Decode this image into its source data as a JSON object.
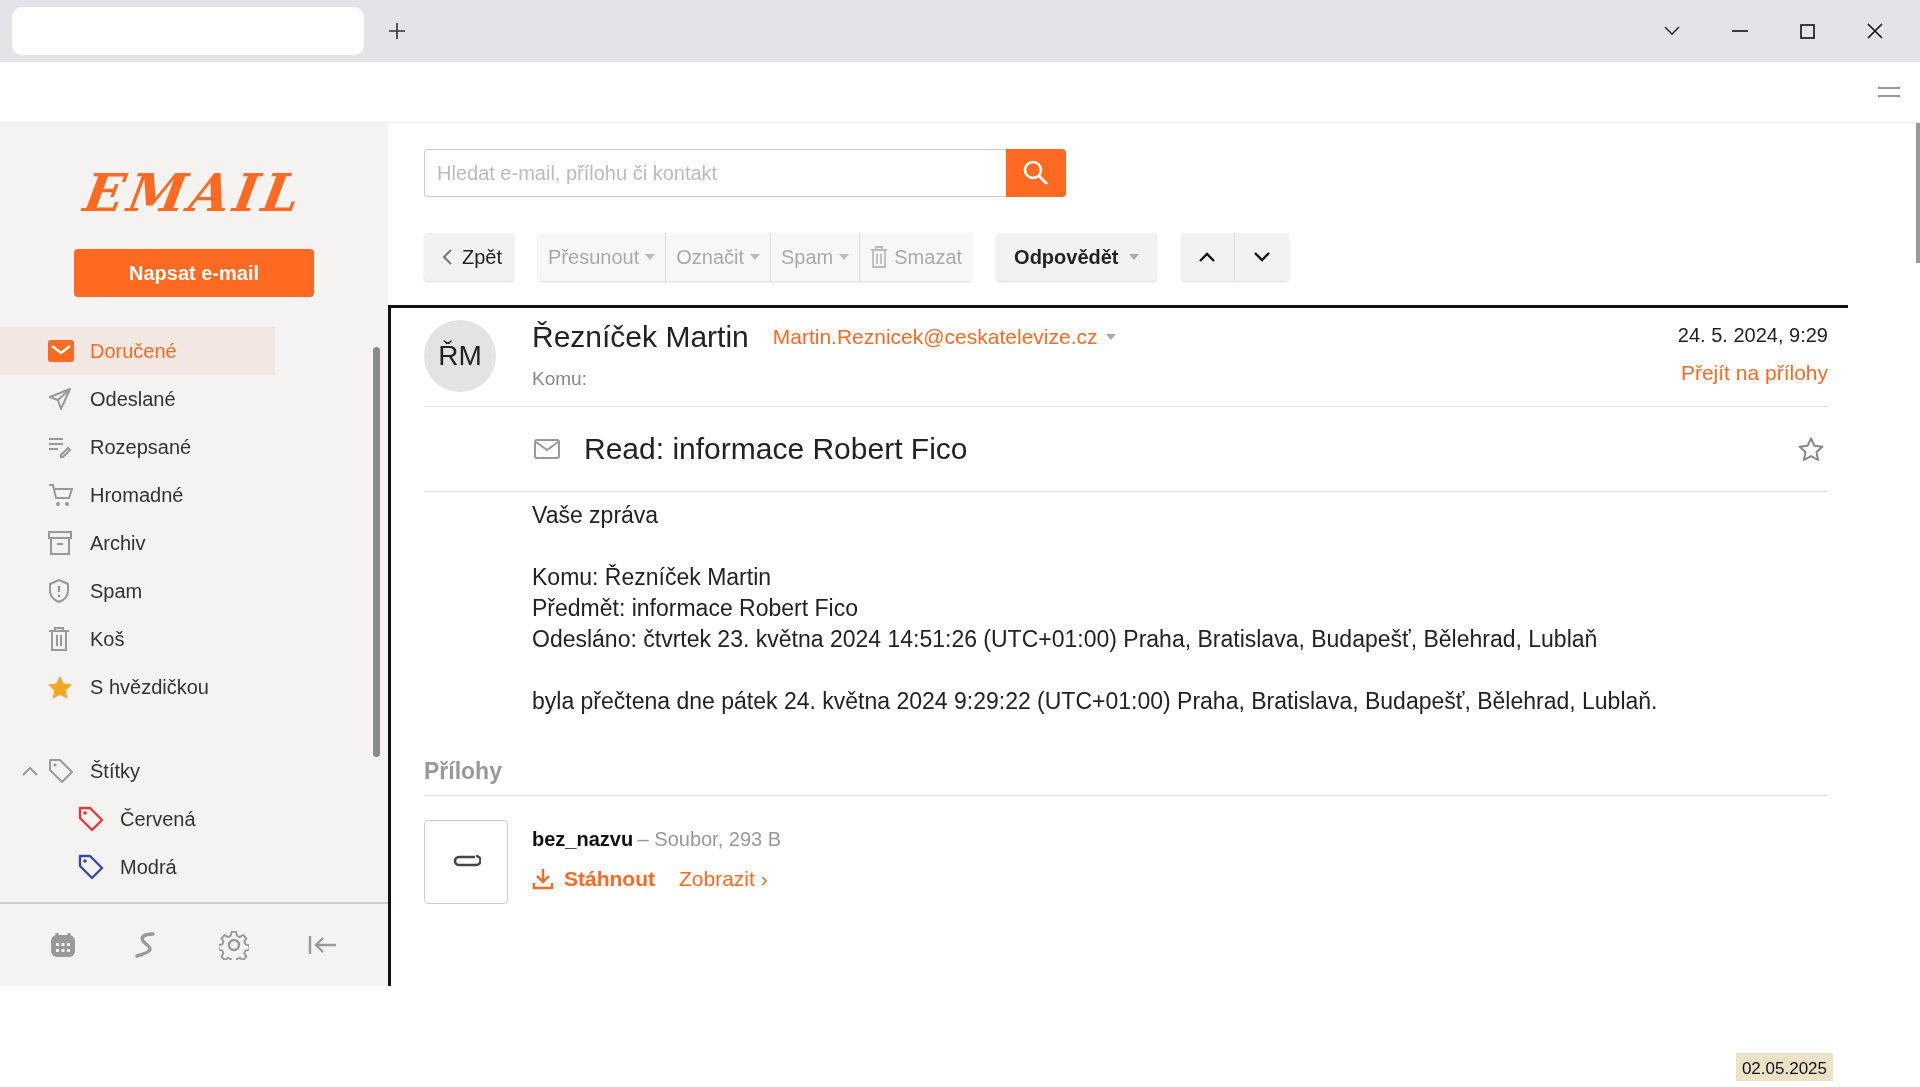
{
  "sidebar": {
    "logo": "EMAIL",
    "compose": "Napsat e-mail",
    "folders": [
      {
        "label": "Doručené",
        "kind": "inbox",
        "selected": true
      },
      {
        "label": "Odeslané",
        "kind": "sent",
        "selected": false
      },
      {
        "label": "Rozepsané",
        "kind": "drafts",
        "selected": false
      },
      {
        "label": "Hromadné",
        "kind": "bulk",
        "selected": false
      },
      {
        "label": "Archiv",
        "kind": "archive",
        "selected": false
      },
      {
        "label": "Spam",
        "kind": "spam",
        "selected": false
      },
      {
        "label": "Koš",
        "kind": "trash",
        "selected": false
      },
      {
        "label": "S hvězdičkou",
        "kind": "starred",
        "selected": false
      }
    ],
    "labels": {
      "title": "Štítky",
      "expanded": true,
      "children": [
        {
          "label": "Červená",
          "color": "#e53935"
        },
        {
          "label": "Modrá",
          "color": "#3949ab"
        }
      ]
    }
  },
  "search": {
    "placeholder": "Hledat e-mail, přílohu či kontakt"
  },
  "toolbar": {
    "back": "Zpět",
    "actions": [
      {
        "label": "Přesunout",
        "kind": "dropdown",
        "disabled": true
      },
      {
        "label": "Označit",
        "kind": "dropdown",
        "disabled": true
      },
      {
        "label": "Spam",
        "kind": "dropdown",
        "disabled": true
      },
      {
        "label": "Smazat",
        "kind": "delete",
        "disabled": true
      }
    ],
    "reply": "Odpovědět"
  },
  "message": {
    "avatar": "ŘM",
    "sender": "Řezníček Martin",
    "email": "Martin.Reznicek@ceskatelevize.cz",
    "to_label": "Komu:",
    "date": "24. 5. 2024, 9:29",
    "jump_link": "Přejít na přílohy",
    "subject": "Read: informace Robert Fico",
    "starred": false,
    "body": [
      [
        "Vaše zpráva"
      ],
      [
        "Komu: Řezníček Martin",
        "Předmět: informace Robert Fico",
        "Odesláno: čtvrtek 23. května 2024 14:51:26 (UTC+01:00) Praha, Bratislava, Budapešť, Bělehrad, Lublaň"
      ],
      [
        "byla přečtena dne pátek 24. května 2024 9:29:22 (UTC+01:00) Praha, Bratislava, Budapešť, Bělehrad, Lublaň."
      ]
    ]
  },
  "attachments": {
    "title": "Přílohy",
    "items": [
      {
        "name": "bez_nazvu",
        "meta": "– Soubor, 293 B",
        "download": "Stáhnout",
        "view": "Zobrazit ›"
      }
    ]
  },
  "date_stamp": "02.05.2025"
}
